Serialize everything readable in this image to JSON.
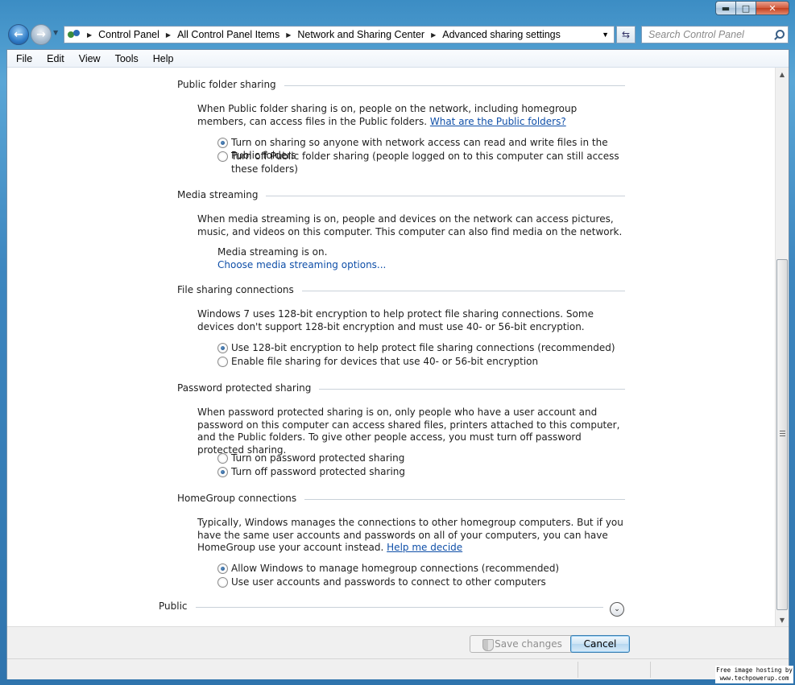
{
  "window": {
    "caption_buttons": {
      "minimize": "▬",
      "maximize": "□",
      "close": "✕"
    }
  },
  "navigation": {
    "back_icon": "arrow-left-icon",
    "forward_icon": "arrow-right-icon",
    "breadcrumbs": [
      "Control Panel",
      "All Control Panel Items",
      "Network and Sharing Center",
      "Advanced sharing settings"
    ],
    "search_placeholder": "Search Control Panel"
  },
  "menu": [
    "File",
    "Edit",
    "View",
    "Tools",
    "Help"
  ],
  "sections": {
    "public_folder": {
      "title": "Public folder sharing",
      "description": "When Public folder sharing is on, people on the network, including homegroup members, can access files in the Public folders.",
      "link": "What are the Public folders?",
      "options": [
        {
          "label": "Turn on sharing so anyone with network access can read and write files in the Public folders",
          "checked": true
        },
        {
          "label": "Turn off Public folder sharing (people logged on to this computer can still access these folders)",
          "checked": false
        }
      ]
    },
    "media_streaming": {
      "title": "Media streaming",
      "description": "When media streaming is on, people and devices on the network can access pictures, music, and videos on this computer. This computer can also find media on the network.",
      "status": "Media streaming is on.",
      "link": "Choose media streaming options..."
    },
    "file_sharing": {
      "title": "File sharing connections",
      "description": "Windows 7 uses 128-bit encryption to help protect file sharing connections. Some devices don't support 128-bit encryption and must use 40- or 56-bit encryption.",
      "options": [
        {
          "label": "Use 128-bit encryption to help protect file sharing connections (recommended)",
          "checked": true
        },
        {
          "label": "Enable file sharing for devices that use 40- or 56-bit encryption",
          "checked": false
        }
      ]
    },
    "password_sharing": {
      "title": "Password protected sharing",
      "description": "When password protected sharing is on, only people who have a user account and password on this computer can access shared files, printers attached to this computer, and the Public folders. To give other people access, you must turn off password protected sharing.",
      "options": [
        {
          "label": "Turn on password protected sharing",
          "checked": false
        },
        {
          "label": "Turn off password protected sharing",
          "checked": true
        }
      ]
    },
    "homegroup": {
      "title": "HomeGroup connections",
      "description": "Typically, Windows manages the connections to other homegroup computers. But if you have the same user accounts and passwords on all of your computers, you can have HomeGroup use your account instead.",
      "link": "Help me decide",
      "options": [
        {
          "label": "Allow Windows to manage homegroup connections (recommended)",
          "checked": true
        },
        {
          "label": "Use user accounts and passwords to connect to other computers",
          "checked": false
        }
      ]
    },
    "public_profile": {
      "title": "Public"
    }
  },
  "footer": {
    "save_label": "Save changes",
    "cancel_label": "Cancel"
  },
  "watermark": {
    "line1": "Free image hosting by",
    "line2": "www.techpowerup.com"
  }
}
